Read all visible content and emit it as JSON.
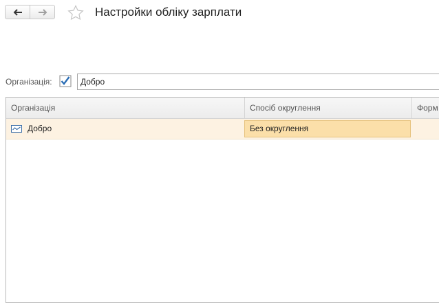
{
  "header": {
    "title": "Настройки обліку зарплати",
    "back_icon": "arrow-left-icon",
    "forward_icon": "arrow-right-icon",
    "favorite_icon": "star-outline-icon"
  },
  "filter": {
    "label": "Організація:",
    "checked": true,
    "value": "Добро"
  },
  "table": {
    "columns": [
      "Організація",
      "Спосіб округлення",
      "Форм"
    ],
    "rows": [
      {
        "organization": "Добро",
        "rounding": "Без округлення",
        "icon": "organization-icon"
      }
    ]
  },
  "colors": {
    "selected_row": "#fdf2e2",
    "active_cell": "#fbdfa9",
    "checkbox_accent": "#2a6db5"
  }
}
